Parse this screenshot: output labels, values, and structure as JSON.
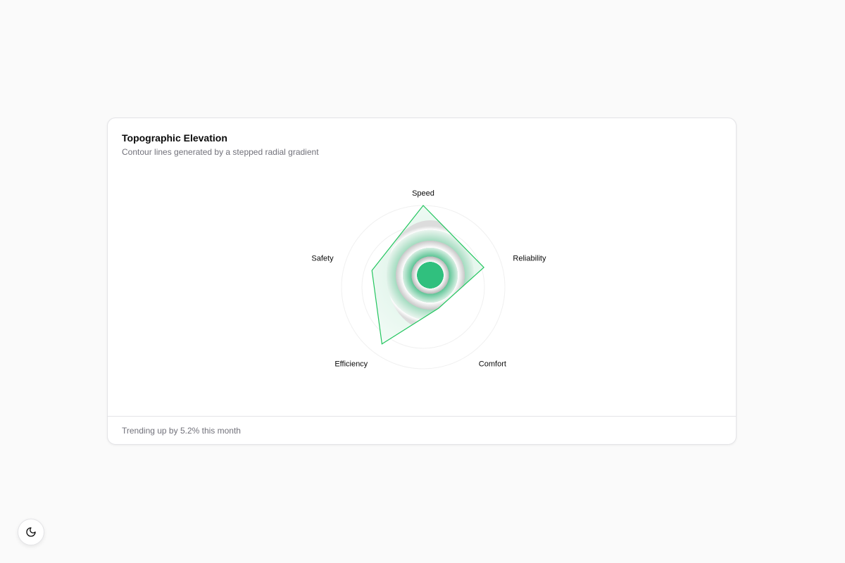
{
  "card": {
    "title": "Topographic Elevation",
    "subtitle": "Contour lines generated by a stepped radial gradient",
    "footer": "Trending up by 5.2% this month"
  },
  "theme_toggle": {
    "icon": "moon-icon"
  },
  "colors": {
    "accent": "#22c55e",
    "accent_fill": "#30c07e",
    "grid": "#f0f0f0",
    "background": "#fafafa",
    "card": "#ffffff"
  },
  "chart_data": {
    "type": "radar",
    "categories": [
      "Speed",
      "Reliability",
      "Comfort",
      "Efficiency",
      "Safety"
    ],
    "series": [
      {
        "values": [
          100,
          78,
          32,
          86,
          66
        ]
      }
    ],
    "rlim": [
      0,
      100
    ],
    "grid": true,
    "legend": "none"
  }
}
